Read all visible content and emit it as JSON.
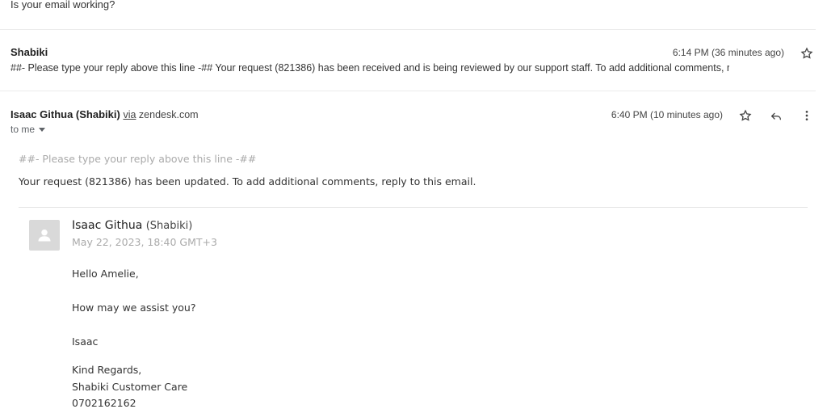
{
  "previous_message": {
    "text": "Is your email working?"
  },
  "collapsed_message": {
    "sender": "Shabiki",
    "time": "6:14 PM (36 minutes ago)",
    "snippet": "##- Please type your reply above this line -## Your request (821386) has been received and is being reviewed by our support staff. To add additional comments, r"
  },
  "expanded_message": {
    "sender_name": "Isaac Githua (Shabiki)",
    "via_label": "via",
    "via_domain": "zendesk.com",
    "recipient": "to me",
    "time": "6:40 PM (10 minutes ago)",
    "body": {
      "reply_marker": "##- Please type your reply above this line -##",
      "update_text": "Your request (821386) has been updated. To add additional comments, reply to this email.",
      "agent": {
        "name": "Isaac Githua",
        "org": "(Shabiki)",
        "date": "May 22, 2023, 18:40 GMT+3"
      },
      "lines": [
        "Hello Amelie,",
        "How may we assist you?",
        "Isaac",
        "Kind Regards,",
        "Shabiki Customer Care",
        "0702162162"
      ]
    }
  },
  "icons": {
    "star": "star-icon",
    "reply": "reply-icon",
    "more": "more-vert-icon",
    "dropdown": "caret-down-icon",
    "avatar": "person-icon"
  }
}
